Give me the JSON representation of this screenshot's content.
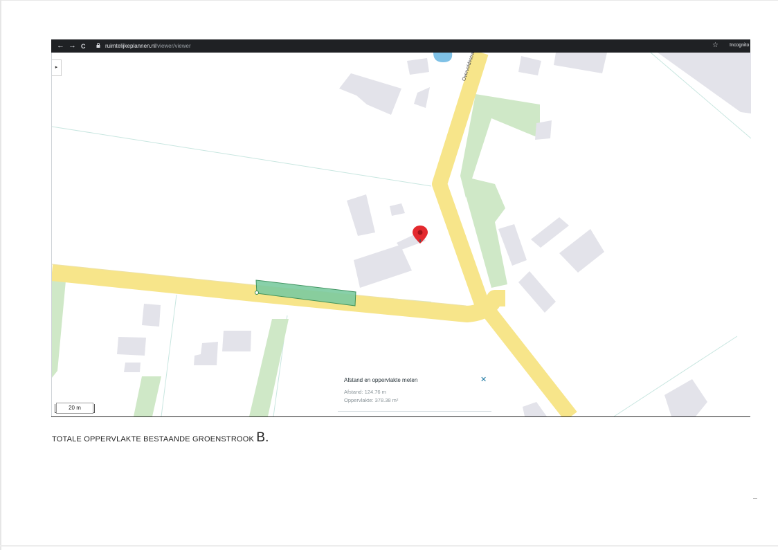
{
  "browser": {
    "nav_back": "←",
    "nav_forward": "→",
    "nav_reload": "C",
    "url_host": "ruimtelijkeplannen.nl",
    "url_path": "/viewer/viewer",
    "star": "☆",
    "incognito_label": "Incognito"
  },
  "map": {
    "sidebar_toggle": "▸",
    "street_label": "Overveldestraat",
    "scale_label": "20 m",
    "colors": {
      "road": "#f7e58a",
      "green": "#cfe8c7",
      "building": "#e3e3ea",
      "selection": "#7ccba0",
      "marker": "#e3292e",
      "water": "#7fc1e6"
    },
    "icons": [
      "location-marker-icon",
      "lock-icon",
      "star-icon",
      "close-icon"
    ]
  },
  "measure": {
    "title": "Afstand en oppervlakte meten",
    "close": "✕",
    "distance": "Afstand: 124.76 m",
    "area": "Oppervlakte: 378.38 m²"
  },
  "caption": {
    "text": "TOTALE OPPERVLAKTE BESTAANDE GROENSTROOK",
    "letter": "B."
  }
}
